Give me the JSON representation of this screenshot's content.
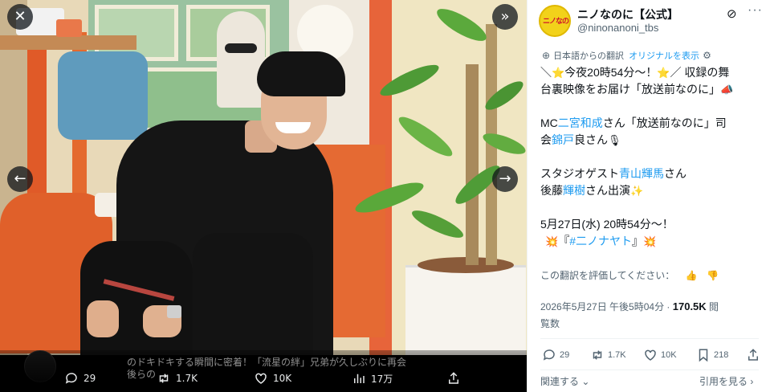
{
  "viewer": {
    "close_icon": "close-icon",
    "collapse_icon": "chevron-double-right-icon",
    "prev_icon": "arrow-left-icon",
    "next_icon": "arrow-right-icon",
    "caption_line1": "のドキドキする瞬間に密着！「流星の絆」兄弟が久しぶりに再会",
    "caption_line2": "後らの",
    "reply_count": "29",
    "retweet_count": "1.7K",
    "like_count": "10K",
    "view_count": "17万"
  },
  "tweet": {
    "display_name": "ニノなのに【公式】",
    "handle": "@ninonanoni_tbs",
    "avatar_text": "ニノなのに",
    "translated_from": "日本語からの翻訳",
    "show_original": "オリジナルを表示",
    "body": {
      "l1a": "＼",
      "l1b": "今夜20時54分〜！",
      "l1c": "／ 収録の舞",
      "l2": "台裏映像をお届け「放送前なのに」",
      "l3a": "MC",
      "l3b": "二宮和成",
      "l3c": "さん「放送前なのに」司",
      "l4a": "会",
      "l4b": "錦戸",
      "l4c": "良さん",
      "l5a": "スタジオゲスト",
      "l5b": "青山輝馬",
      "l5c": "さん",
      "l6a": "後藤",
      "l6b": "輝樹",
      "l6c": "さん出演",
      "l7": "5月27日(水) 20時54分〜！",
      "l8a": "『",
      "l8b": "#二ノナヤト",
      "l8c": "』"
    },
    "rate_translation": "この翻訳を評価してください：",
    "timestamp": "2026年5月27日 午後5時04分 ·",
    "views_num": "170.5K",
    "views_label1": "閲",
    "views_label2": "覧数",
    "reply_count": "29",
    "retweet_count": "1.7K",
    "like_count": "10K",
    "bookmark_count": "218",
    "related": "関連する",
    "quotes": "引用を見る"
  },
  "colors": {
    "accent": "#1d9bf0",
    "text": "#0f1419",
    "muted": "#536471"
  }
}
